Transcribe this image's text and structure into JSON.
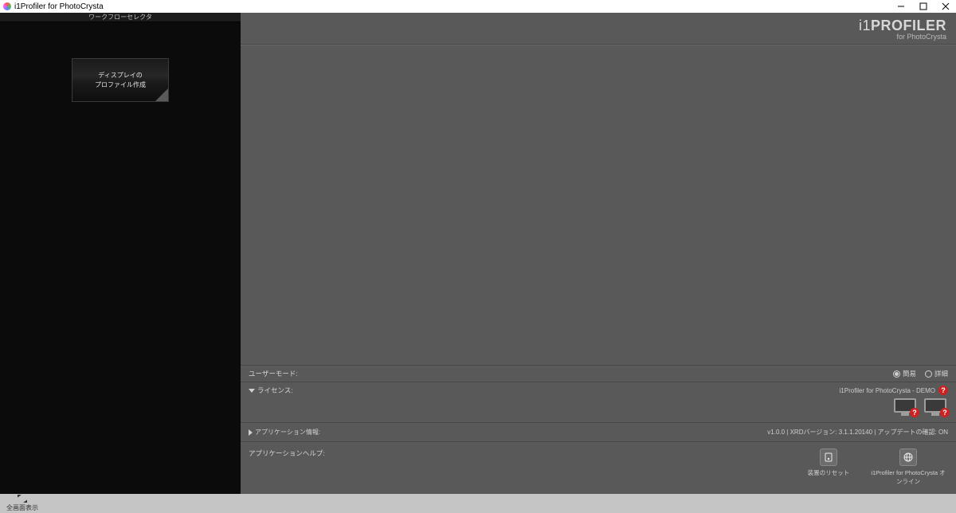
{
  "titlebar": {
    "title": "i1Profiler for PhotoCrysta"
  },
  "sidebar": {
    "header": "ワークフローセレクタ",
    "workflow": {
      "line1": "ディスプレイの",
      "line2": "プロファイル作成"
    }
  },
  "logo": {
    "prefix": "i1",
    "main": "PROFILER",
    "sub": "for PhotoCrysta"
  },
  "user_mode": {
    "label": "ユーザーモード:",
    "opt_simple": "簡易",
    "opt_detail": "詳細",
    "selected": "simple"
  },
  "license": {
    "label": "ライセンス:",
    "status": "i1Profiler for PhotoCrysta - DEMO"
  },
  "app_info": {
    "label": "アプリケーション情報:",
    "detail": "v1.0.0 | XRDバージョン: 3.1.1.20140 | アップデートの確認: ON"
  },
  "help": {
    "label": "アプリケーションヘルプ:",
    "items": [
      {
        "label": "装置のリセット"
      },
      {
        "label": "i1Profiler for PhotoCrysta オンライン"
      }
    ]
  },
  "statusbar": {
    "fullscreen": "全画面表示"
  }
}
